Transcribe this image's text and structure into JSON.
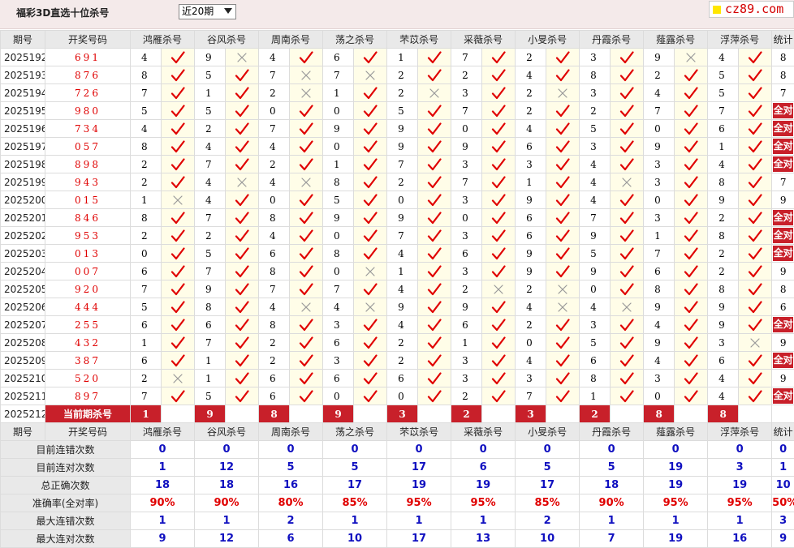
{
  "header": {
    "title": "福彩3D直选十位杀号",
    "select_value": "近20期",
    "logo": "cz89.com"
  },
  "columns": {
    "period": "期号",
    "draw": "开奖号码",
    "killers": [
      "鸿雁杀号",
      "谷风杀号",
      "周南杀号",
      "荡之杀号",
      "芣苡杀号",
      "采薇杀号",
      "小旻杀号",
      "丹霞杀号",
      "薤露杀号",
      "浮萍杀号"
    ],
    "stats": "统计"
  },
  "rows": [
    {
      "period": "2025192",
      "draw": "691",
      "k": [
        "4",
        "9",
        "4",
        "6",
        "1",
        "7",
        "2",
        "3",
        "9",
        "4"
      ],
      "r": [
        1,
        0,
        1,
        1,
        1,
        1,
        1,
        1,
        0,
        1
      ],
      "stat": "8"
    },
    {
      "period": "2025193",
      "draw": "876",
      "k": [
        "8",
        "5",
        "7",
        "7",
        "2",
        "2",
        "4",
        "8",
        "2",
        "5"
      ],
      "r": [
        1,
        1,
        0,
        0,
        1,
        1,
        1,
        1,
        1,
        1
      ],
      "stat": "8"
    },
    {
      "period": "2025194",
      "draw": "726",
      "k": [
        "7",
        "1",
        "2",
        "1",
        "2",
        "3",
        "2",
        "3",
        "4",
        "5"
      ],
      "r": [
        1,
        1,
        0,
        1,
        0,
        1,
        0,
        1,
        1,
        1
      ],
      "stat": "7"
    },
    {
      "period": "2025195",
      "draw": "980",
      "k": [
        "5",
        "5",
        "0",
        "0",
        "5",
        "7",
        "2",
        "2",
        "7",
        "7"
      ],
      "r": [
        1,
        1,
        1,
        1,
        1,
        1,
        1,
        1,
        1,
        1
      ],
      "stat": "全对"
    },
    {
      "period": "2025196",
      "draw": "734",
      "k": [
        "4",
        "2",
        "7",
        "9",
        "9",
        "0",
        "4",
        "5",
        "0",
        "6"
      ],
      "r": [
        1,
        1,
        1,
        1,
        1,
        1,
        1,
        1,
        1,
        1
      ],
      "stat": "全对"
    },
    {
      "period": "2025197",
      "draw": "057",
      "k": [
        "8",
        "4",
        "4",
        "0",
        "9",
        "9",
        "6",
        "3",
        "9",
        "1"
      ],
      "r": [
        1,
        1,
        1,
        1,
        1,
        1,
        1,
        1,
        1,
        1
      ],
      "stat": "全对"
    },
    {
      "period": "2025198",
      "draw": "898",
      "k": [
        "2",
        "7",
        "2",
        "1",
        "7",
        "3",
        "3",
        "4",
        "3",
        "4"
      ],
      "r": [
        1,
        1,
        1,
        1,
        1,
        1,
        1,
        1,
        1,
        1
      ],
      "stat": "全对"
    },
    {
      "period": "2025199",
      "draw": "943",
      "k": [
        "2",
        "4",
        "4",
        "8",
        "2",
        "7",
        "1",
        "4",
        "3",
        "8"
      ],
      "r": [
        1,
        0,
        0,
        1,
        1,
        1,
        1,
        0,
        1,
        1
      ],
      "stat": "7"
    },
    {
      "period": "2025200",
      "draw": "015",
      "k": [
        "1",
        "4",
        "0",
        "5",
        "0",
        "3",
        "9",
        "4",
        "0",
        "9"
      ],
      "r": [
        0,
        1,
        1,
        1,
        1,
        1,
        1,
        1,
        1,
        1
      ],
      "stat": "9"
    },
    {
      "period": "2025201",
      "draw": "846",
      "k": [
        "8",
        "7",
        "8",
        "9",
        "9",
        "0",
        "6",
        "7",
        "3",
        "2"
      ],
      "r": [
        1,
        1,
        1,
        1,
        1,
        1,
        1,
        1,
        1,
        1
      ],
      "stat": "全对"
    },
    {
      "period": "2025202",
      "draw": "953",
      "k": [
        "2",
        "2",
        "4",
        "0",
        "7",
        "3",
        "6",
        "9",
        "1",
        "8"
      ],
      "r": [
        1,
        1,
        1,
        1,
        1,
        1,
        1,
        1,
        1,
        1
      ],
      "stat": "全对"
    },
    {
      "period": "2025203",
      "draw": "013",
      "k": [
        "0",
        "5",
        "6",
        "8",
        "4",
        "6",
        "9",
        "5",
        "7",
        "2"
      ],
      "r": [
        1,
        1,
        1,
        1,
        1,
        1,
        1,
        1,
        1,
        1
      ],
      "stat": "全对"
    },
    {
      "period": "2025204",
      "draw": "007",
      "k": [
        "6",
        "7",
        "8",
        "0",
        "1",
        "3",
        "9",
        "9",
        "6",
        "2"
      ],
      "r": [
        1,
        1,
        1,
        0,
        1,
        1,
        1,
        1,
        1,
        1
      ],
      "stat": "9"
    },
    {
      "period": "2025205",
      "draw": "920",
      "k": [
        "7",
        "9",
        "7",
        "7",
        "4",
        "2",
        "2",
        "0",
        "8",
        "8"
      ],
      "r": [
        1,
        1,
        1,
        1,
        1,
        0,
        0,
        1,
        1,
        1
      ],
      "stat": "8"
    },
    {
      "period": "2025206",
      "draw": "444",
      "k": [
        "5",
        "8",
        "4",
        "4",
        "9",
        "9",
        "4",
        "4",
        "9",
        "9"
      ],
      "r": [
        1,
        1,
        0,
        0,
        1,
        1,
        0,
        0,
        1,
        1
      ],
      "stat": "6"
    },
    {
      "period": "2025207",
      "draw": "255",
      "k": [
        "6",
        "6",
        "8",
        "3",
        "4",
        "6",
        "2",
        "3",
        "4",
        "9"
      ],
      "r": [
        1,
        1,
        1,
        1,
        1,
        1,
        1,
        1,
        1,
        1
      ],
      "stat": "全对"
    },
    {
      "period": "2025208",
      "draw": "432",
      "k": [
        "1",
        "7",
        "2",
        "6",
        "2",
        "1",
        "0",
        "5",
        "9",
        "3"
      ],
      "r": [
        1,
        1,
        1,
        1,
        1,
        1,
        1,
        1,
        1,
        0
      ],
      "stat": "9"
    },
    {
      "period": "2025209",
      "draw": "387",
      "k": [
        "6",
        "1",
        "2",
        "3",
        "2",
        "3",
        "4",
        "6",
        "4",
        "6"
      ],
      "r": [
        1,
        1,
        1,
        1,
        1,
        1,
        1,
        1,
        1,
        1
      ],
      "stat": "全对"
    },
    {
      "period": "2025210",
      "draw": "520",
      "k": [
        "2",
        "1",
        "6",
        "6",
        "6",
        "3",
        "3",
        "8",
        "3",
        "4"
      ],
      "r": [
        0,
        1,
        1,
        1,
        1,
        1,
        1,
        1,
        1,
        1
      ],
      "stat": "9"
    },
    {
      "period": "2025211",
      "draw": "897",
      "k": [
        "7",
        "5",
        "6",
        "0",
        "0",
        "2",
        "7",
        "1",
        "0",
        "4"
      ],
      "r": [
        1,
        1,
        1,
        1,
        1,
        1,
        1,
        1,
        1,
        1
      ],
      "stat": "全对"
    }
  ],
  "current": {
    "period": "2025212",
    "label": "当前期杀号",
    "k": [
      "1",
      "9",
      "8",
      "9",
      "3",
      "2",
      "3",
      "2",
      "8",
      "8"
    ]
  },
  "summary": [
    {
      "label": "目前连错次数",
      "values": [
        "0",
        "0",
        "0",
        "0",
        "0",
        "0",
        "0",
        "0",
        "0",
        "0"
      ],
      "stat": "0"
    },
    {
      "label": "目前连对次数",
      "values": [
        "1",
        "12",
        "5",
        "5",
        "17",
        "6",
        "5",
        "5",
        "19",
        "3"
      ],
      "stat": "1"
    },
    {
      "label": "总正确次数",
      "values": [
        "18",
        "18",
        "16",
        "17",
        "19",
        "19",
        "17",
        "18",
        "19",
        "19"
      ],
      "stat": "10"
    },
    {
      "label": "准确率(全对率)",
      "values": [
        "90%",
        "90%",
        "80%",
        "85%",
        "95%",
        "95%",
        "85%",
        "90%",
        "95%",
        "95%"
      ],
      "stat": "50%",
      "red": true
    },
    {
      "label": "最大连错次数",
      "values": [
        "1",
        "1",
        "2",
        "1",
        "1",
        "1",
        "2",
        "1",
        "1",
        "1"
      ],
      "stat": "3"
    },
    {
      "label": "最大连对次数",
      "values": [
        "9",
        "12",
        "6",
        "10",
        "17",
        "13",
        "10",
        "7",
        "19",
        "16"
      ],
      "stat": "9"
    }
  ]
}
